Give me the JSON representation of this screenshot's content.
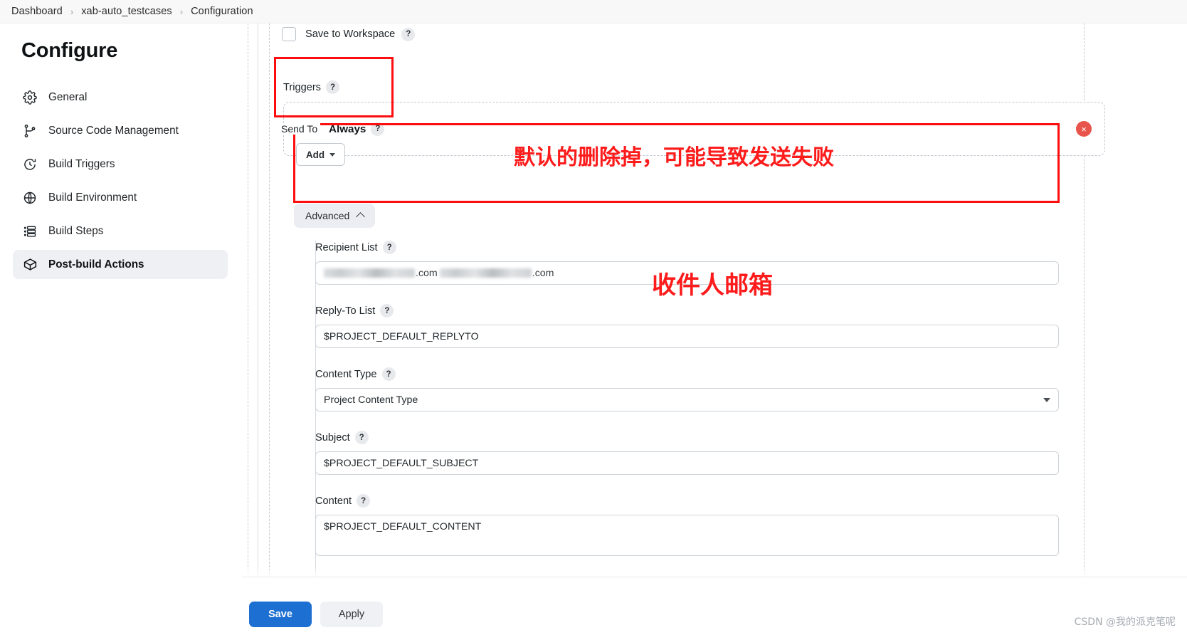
{
  "breadcrumb": {
    "items": [
      {
        "label": "Dashboard"
      },
      {
        "label": "xab-auto_testcases"
      },
      {
        "label": "Configuration"
      }
    ],
    "separator": "›"
  },
  "sidebar": {
    "title": "Configure",
    "items": [
      {
        "label": "General",
        "icon": "gear-icon",
        "active": false
      },
      {
        "label": "Source Code Management",
        "icon": "branch-icon",
        "active": false
      },
      {
        "label": "Build Triggers",
        "icon": "clock-icon",
        "active": false
      },
      {
        "label": "Build Environment",
        "icon": "globe-icon",
        "active": false
      },
      {
        "label": "Build Steps",
        "icon": "list-icon",
        "active": false
      },
      {
        "label": "Post-build Actions",
        "icon": "package-icon",
        "active": true
      }
    ]
  },
  "form": {
    "save_to_workspace": {
      "label": "Save to Workspace",
      "checked": false,
      "help": "?"
    },
    "triggers": {
      "label": "Triggers",
      "help": "?"
    },
    "trigger_item": {
      "label": "Always",
      "help": "?",
      "drag_handle": "hamburger-icon",
      "remove": "×"
    },
    "send_to": {
      "label": "Send To",
      "add_button": "Add",
      "caret": "▾"
    },
    "advanced": {
      "label": "Advanced",
      "expanded": true
    },
    "fields": [
      {
        "key": "recipient_list",
        "label": "Recipient List",
        "help": "?",
        "type": "blurred-text",
        "value_suffix_1": ".com",
        "value_suffix_2": ".com",
        "redacted": true
      },
      {
        "key": "reply_to_list",
        "label": "Reply-To List",
        "help": "?",
        "type": "text",
        "value": "$PROJECT_DEFAULT_REPLYTO"
      },
      {
        "key": "content_type",
        "label": "Content Type",
        "help": "?",
        "type": "select",
        "value": "Project Content Type"
      },
      {
        "key": "subject",
        "label": "Subject",
        "help": "?",
        "type": "text",
        "value": "$PROJECT_DEFAULT_SUBJECT"
      },
      {
        "key": "content",
        "label": "Content",
        "help": "?",
        "type": "textarea",
        "value": "$PROJECT_DEFAULT_CONTENT"
      }
    ]
  },
  "annotations": [
    {
      "id": "note-delete-default",
      "text": "默认的删除掉，可能导致发送失败",
      "color": "#fd1b1b"
    },
    {
      "id": "note-recipient-mailbox",
      "text": "收件人邮箱",
      "color": "#fd1b1b"
    }
  ],
  "footer": {
    "save_label": "Save",
    "apply_label": "Apply",
    "watermark": "CSDN @我的派克笔呢"
  },
  "colors": {
    "accent_blue": "#1d6fd1",
    "annotation_red": "#fd1b1b",
    "close_red": "#e8544b",
    "sidebar_active_bg": "#eef0f4"
  }
}
